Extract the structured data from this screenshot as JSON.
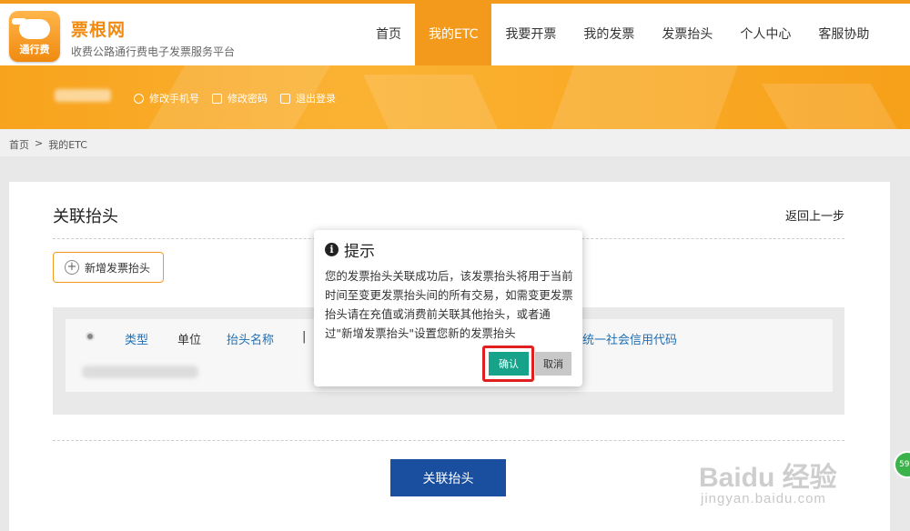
{
  "header": {
    "logo_text": "通行费",
    "brand": "票根网",
    "slogan": "收费公路通行费电子发票服务平台",
    "nav": [
      "首页",
      "我的ETC",
      "我要开票",
      "我的发票",
      "发票抬头",
      "个人中心",
      "客服协助"
    ],
    "active_nav": "我的ETC"
  },
  "banner": {
    "links": [
      "修改手机号",
      "修改密码",
      "退出登录"
    ]
  },
  "breadcrumb": [
    "首页",
    ">",
    "我的ETC"
  ],
  "card": {
    "title": "关联抬头",
    "back": "返回上一步",
    "add_button": "新增发票抬头",
    "table_headers": [
      "类型",
      "单位",
      "抬头名称",
      "|",
      "统一社会信用代码"
    ],
    "submit": "关联抬头"
  },
  "modal": {
    "title": "提示",
    "body": "您的发票抬头关联成功后，该发票抬头将用于当前时间至变更发票抬头间的所有交易，如需变更发票抬头请在充值或消费前关联其他抬头，或者通过\"新增发票抬头\"设置您新的发票抬头",
    "confirm": "确认",
    "cancel": "取消"
  },
  "watermark": {
    "text": "Baidu 经验",
    "sub": "jingyan.baidu.com"
  },
  "side_badge": "59",
  "colors": {
    "accent": "#f39a1c",
    "primary_button": "#1a4fa0",
    "confirm_button": "#17a28a",
    "highlight": "#e02020"
  }
}
